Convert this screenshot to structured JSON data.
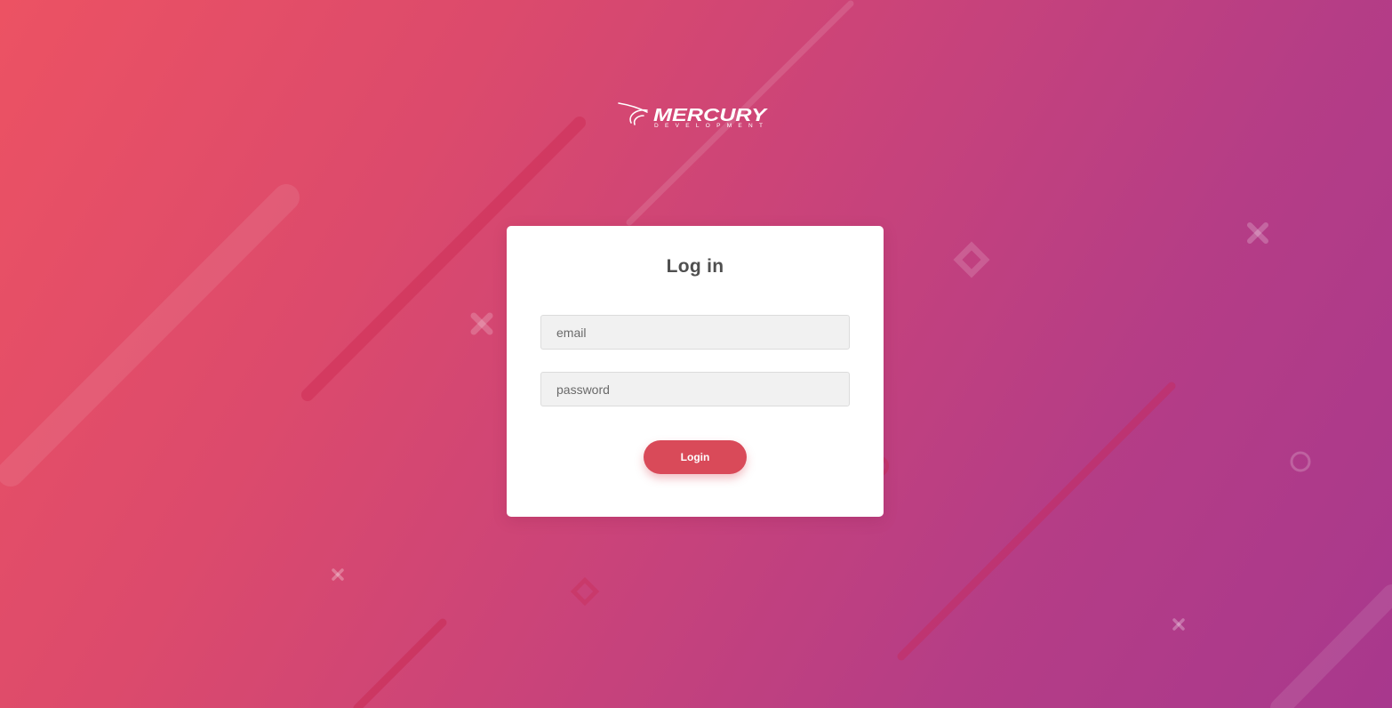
{
  "brand": {
    "name": "MERCURY",
    "tagline": "DEVELOPMENT",
    "logo_icon": "rocket-swoosh-icon"
  },
  "login_form": {
    "title": "Log in",
    "email": {
      "placeholder": "email",
      "value": ""
    },
    "password": {
      "placeholder": "password",
      "value": ""
    },
    "submit_label": "Login"
  },
  "colors": {
    "gradient_start": "#ec5263",
    "gradient_end": "#a8388d",
    "accent": "#d94a59",
    "card_background": "#ffffff",
    "input_background": "#f1f1f1",
    "title_text": "#4f4f4f"
  },
  "decorations": {
    "icons": [
      "x-mark-icon",
      "diamond-icon",
      "ring-icon",
      "diagonal-streak"
    ]
  }
}
